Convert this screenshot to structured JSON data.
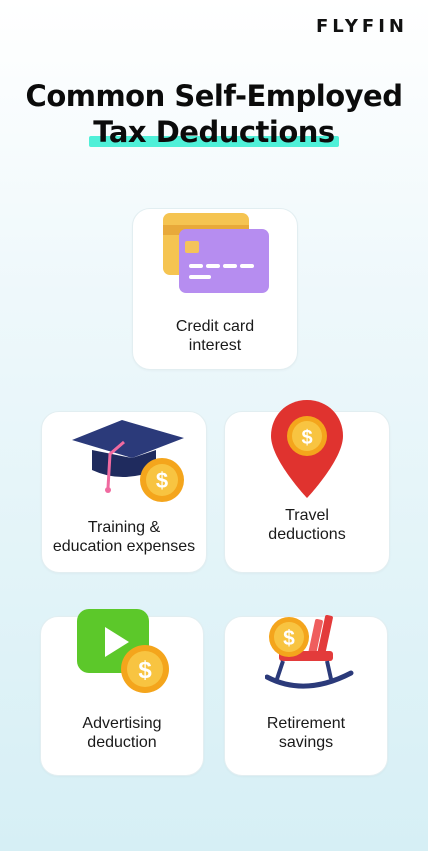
{
  "brand": {
    "logo": "FLYFIN"
  },
  "header": {
    "title_line1": "Common Self-Employed",
    "title_line2": "Tax Deductions"
  },
  "cards": [
    {
      "line1": "Credit card",
      "line2": "interest",
      "icon": "credit-card-icon"
    },
    {
      "line1": "Training &",
      "line2": "education expenses",
      "icon": "graduation-cap-icon"
    },
    {
      "line1": "Travel",
      "line2": "deductions",
      "icon": "location-pin-icon"
    },
    {
      "line1": "Advertising",
      "line2": "deduction",
      "icon": "play-button-icon"
    },
    {
      "line1": "Retirement",
      "line2": "savings",
      "icon": "rocking-chair-icon"
    }
  ]
}
